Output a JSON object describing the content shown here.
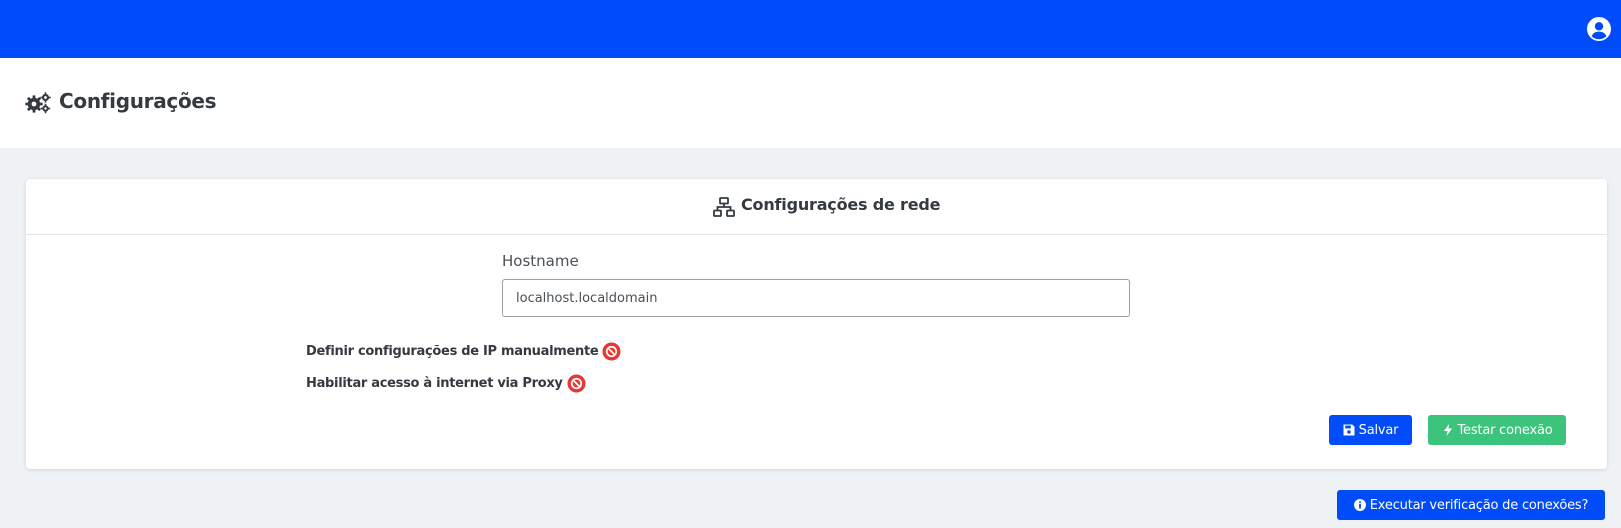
{
  "topbar": {
    "user_icon": "user-circle-icon",
    "color": "#004bfa"
  },
  "page_header": {
    "icon": "gears-icon",
    "title": "Configurações"
  },
  "network_card": {
    "icon": "network-icon",
    "title": "Configurações de rede",
    "hostname": {
      "label": "Hostname",
      "value": "localhost.localdomain"
    },
    "toggles": [
      {
        "label": "Definir configurações de IP manualmente",
        "icon": "ban-icon",
        "state": "disabled"
      },
      {
        "label": "Habilitar acesso à internet via Proxy",
        "icon": "ban-icon",
        "state": "disabled"
      }
    ],
    "buttons": {
      "save_label": "Salvar",
      "save_icon": "save-icon",
      "test_label": "Testar conexão",
      "test_icon": "bolt-icon"
    }
  },
  "check_button": {
    "label": "Executar verificação de conexões?",
    "icon": "info-icon"
  },
  "colors": {
    "primary": "#004bfa",
    "success": "#3cc47c",
    "danger": "#e53935",
    "background": "#eff2f5"
  }
}
